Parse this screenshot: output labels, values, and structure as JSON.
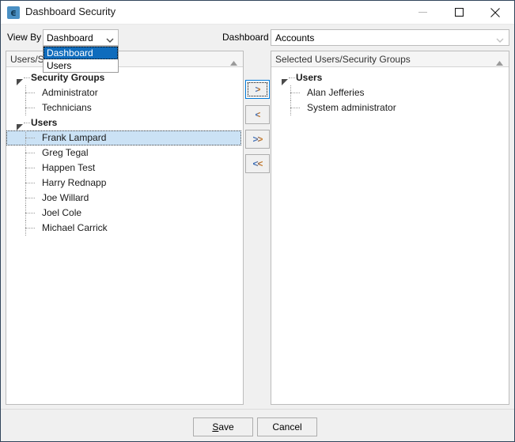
{
  "window": {
    "title": "Dashboard Security",
    "app_icon": "dashboard-icon",
    "controls": {
      "minimize": "minimize-icon",
      "maximize": "maximize-icon",
      "close": "close-icon"
    }
  },
  "toolbar": {
    "view_by_label": "View By",
    "view_by_value": "Dashboard",
    "view_by_options": [
      "Dashboard",
      "Users"
    ],
    "view_by_selected_index": 0,
    "dashboard_label": "Dashboard",
    "dashboard_value": "Accounts"
  },
  "left_panel": {
    "header": "Users/Security Groups",
    "sort_indicator": "sort-ascending-icon",
    "tree": [
      {
        "label": "Security Groups",
        "type": "group",
        "expanded": true,
        "selected": false
      },
      {
        "label": "Administrator",
        "type": "leaf",
        "selected": false
      },
      {
        "label": "Technicians",
        "type": "leaf",
        "selected": false
      },
      {
        "label": "Users",
        "type": "group",
        "expanded": true,
        "selected": false
      },
      {
        "label": "Frank Lampard",
        "type": "leaf",
        "selected": true
      },
      {
        "label": "Greg Tegal",
        "type": "leaf",
        "selected": false
      },
      {
        "label": "Happen Test",
        "type": "leaf",
        "selected": false
      },
      {
        "label": "Harry Rednapp",
        "type": "leaf",
        "selected": false
      },
      {
        "label": "Joe Willard",
        "type": "leaf",
        "selected": false
      },
      {
        "label": "Joel Cole",
        "type": "leaf",
        "selected": false
      },
      {
        "label": "Michael Carrick",
        "type": "leaf",
        "selected": false
      }
    ]
  },
  "right_panel": {
    "header": "Selected Users/Security Groups",
    "sort_indicator": "sort-ascending-icon",
    "tree": [
      {
        "label": "Users",
        "type": "group",
        "expanded": true,
        "selected": false
      },
      {
        "label": "Alan Jefferies",
        "type": "leaf",
        "selected": false
      },
      {
        "label": "System administrator",
        "type": "leaf",
        "selected": false
      }
    ]
  },
  "transfer_buttons": [
    {
      "label": ">",
      "name": "move-right-button",
      "focused": true
    },
    {
      "label": "<",
      "name": "move-left-button",
      "focused": false
    },
    {
      "label": ">>",
      "name": "move-all-right-button",
      "focused": false
    },
    {
      "label": "<<",
      "name": "move-all-left-button",
      "focused": false
    }
  ],
  "footer": {
    "save_label": "Save",
    "save_accel": "S",
    "save_rest": "ave",
    "cancel_label": "Cancel"
  },
  "colors": {
    "accent": "#0f6cbd",
    "selection": "#cbe2f5",
    "focus_border": "#0078d7",
    "window_border": "#31455b",
    "chrome": "#f0f0f0"
  }
}
